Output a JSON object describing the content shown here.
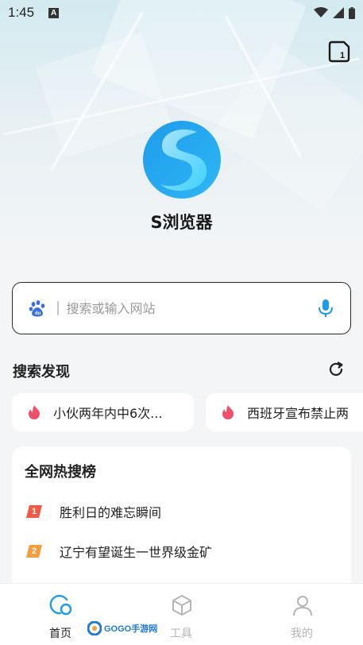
{
  "status_bar": {
    "time": "1:45",
    "notification_letter": "A",
    "icons": [
      "wifi-icon",
      "signal-icon",
      "battery-icon"
    ]
  },
  "header": {
    "tab_count": "1",
    "app_name": "S浏览器"
  },
  "search": {
    "engine_icon": "baidu-paw-icon",
    "placeholder": "搜索或输入网站",
    "mic_icon": "microphone-icon"
  },
  "discover": {
    "title": "搜索发现",
    "chips": [
      {
        "icon": "fire-icon",
        "text": "小伙两年内中6次..."
      },
      {
        "icon": "fire-icon",
        "text": "西班牙宣布禁止两"
      }
    ]
  },
  "hot_list": {
    "title": "全网热搜榜",
    "items": [
      {
        "rank": "1",
        "text": "胜利日的难忘瞬间",
        "color": "#f25a45"
      },
      {
        "rank": "2",
        "text": "辽宁有望诞生一世界级金矿",
        "color": "#f59c3c"
      }
    ]
  },
  "bottom_nav": {
    "items": [
      {
        "label": "首页",
        "icon": "home-icon",
        "active": true
      },
      {
        "label": "工具",
        "icon": "cube-icon",
        "active": false
      },
      {
        "label": "我的",
        "icon": "person-icon",
        "active": false
      }
    ]
  },
  "watermark": {
    "text": "GOGO手游网"
  },
  "colors": {
    "accent": "#1e9bea",
    "logo_light": "#3ec8f5",
    "fire": "#f24e6a",
    "inactive_nav": "#b5b5b5"
  }
}
